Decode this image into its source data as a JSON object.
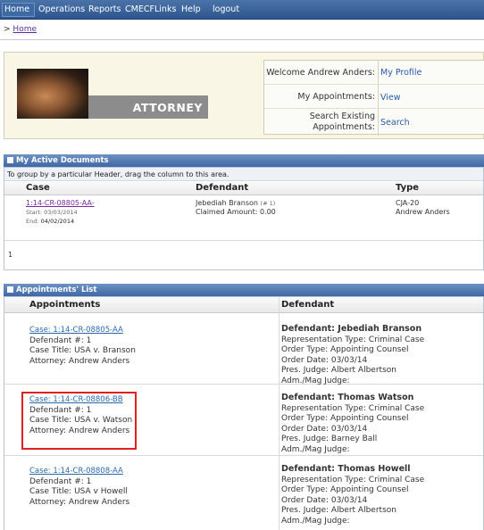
{
  "nav": {
    "items": [
      "Home",
      "Operations",
      "Reports",
      "CMECF",
      "Links",
      "Help",
      "logout"
    ]
  },
  "breadcrumb": {
    "prefix": ">",
    "home": "Home"
  },
  "header": {
    "role_label": "ATTORNEY",
    "welcome_label": "Welcome Andrew Anders:",
    "profile_link": "My Profile",
    "appointments_label": "My Appointments:",
    "appointments_link": "View",
    "search_label_1": "Search Existing",
    "search_label_2": "Appointments:",
    "search_link": "Search"
  },
  "active_documents": {
    "title": "My Active Documents",
    "group_hint": "To group by a particular Header, drag the column to this area.",
    "columns": [
      "Case",
      "Defendant",
      "Type"
    ],
    "row": {
      "case": "1:14-CR-08805-AA-",
      "start_label": "Start:",
      "start": "03/03/2014",
      "end_label": "End:",
      "end": "04/02/2014",
      "defendant": "Jebediah Branson",
      "defendant_num": "(# 1)",
      "claimed": "Claimed Amount: 0.00",
      "type": "CJA-20",
      "attorney": "Andrew Anders"
    },
    "pager": "1"
  },
  "appointments": {
    "title": "Appointments' List",
    "columns": [
      "Appointments",
      "Defendant"
    ],
    "rows": [
      {
        "case": "Case: 1:14-CR-08805-AA",
        "defnum": "Defendant #: 1",
        "title": "Case Title: USA v. Branson",
        "attorney": "Attorney: Andrew Anders",
        "dname": "Defendant: Jebediah Branson",
        "rep": "Representation Type: Criminal Case",
        "order_type": "Order Type: Appointing Counsel",
        "order_date": "Order Date: 03/03/14",
        "pres": "Pres. Judge: Albert Albertson",
        "adm": "Adm./Mag Judge:"
      },
      {
        "case": "Case: 1:14-CR-08806-BB",
        "defnum": "Defendant #: 1",
        "title": "Case Title: USA v. Watson",
        "attorney": "Attorney: Andrew Anders",
        "dname": "Defendant: Thomas Watson",
        "rep": "Representation Type: Criminal Case",
        "order_type": "Order Type: Appointing Counsel",
        "order_date": "Order Date: 03/03/14",
        "pres": "Pres. Judge: Barney Ball",
        "adm": "Adm./Mag Judge:"
      },
      {
        "case": "Case: 1:14-CR-08808-AA",
        "defnum": "Defendant #: 1",
        "title": "Case Title: USA v Howell",
        "attorney": "Attorney: Andrew Anders",
        "dname": "Defendant: Thomas Howell",
        "rep": "Representation Type: Criminal Case",
        "order_type": "Order Type: Appointing Counsel",
        "order_date": "Order Date: 03/03/14",
        "pres": "Pres. Judge: Albert Albertson",
        "adm": "Adm./Mag Judge:"
      }
    ]
  },
  "colors": {
    "nav_blue": "#2d5690",
    "panel_blue": "#3f67a3",
    "highlight_red": "#e02020",
    "header_bg": "#faf6e6"
  }
}
